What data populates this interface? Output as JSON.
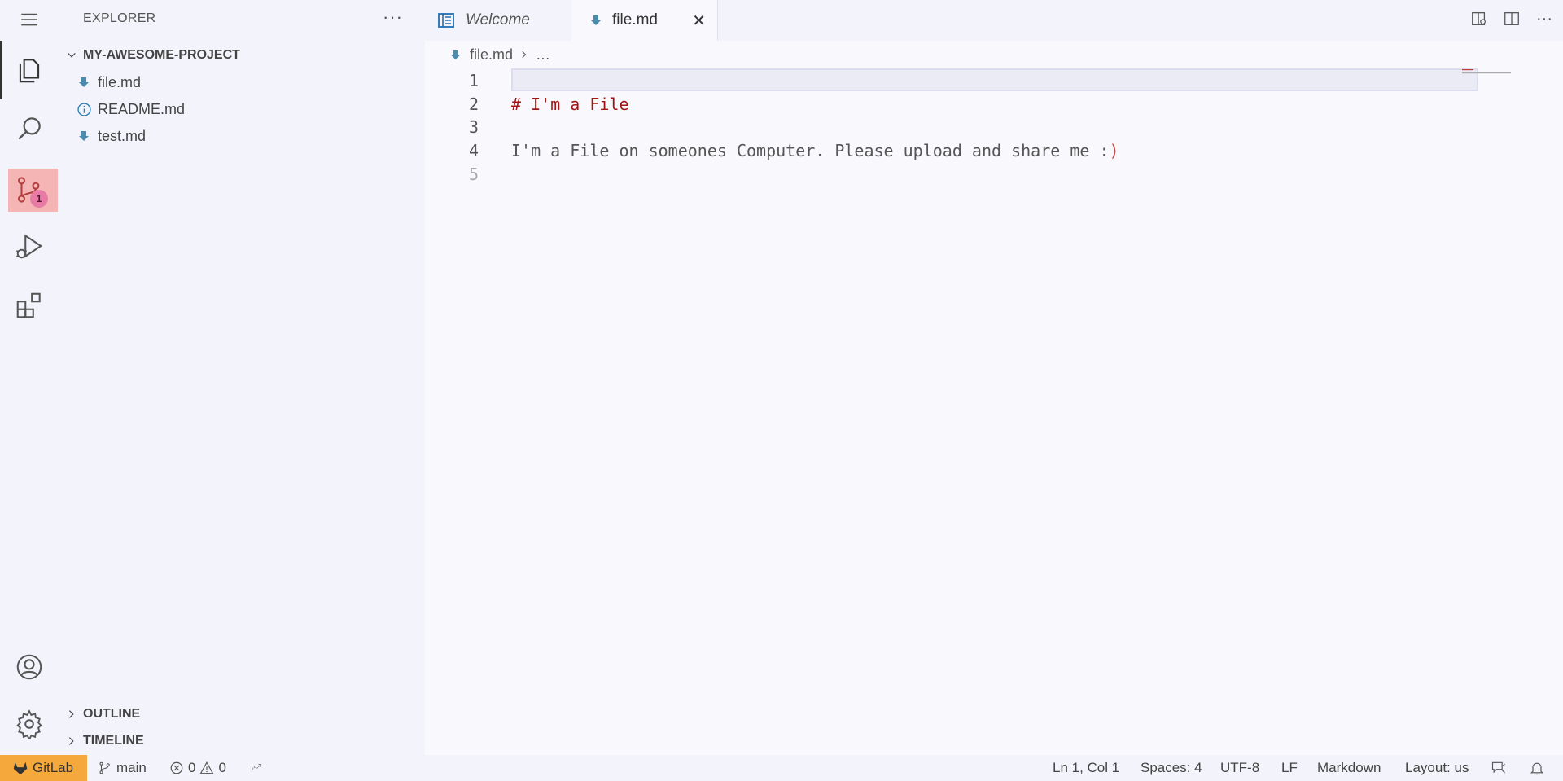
{
  "activity_bar": {
    "items": [
      "menu-icon",
      "files-icon",
      "search-icon",
      "source-control-icon",
      "run-debug-icon",
      "extensions-icon",
      "accounts-icon",
      "settings-icon"
    ],
    "source_control_badge": "1",
    "annotation": "<~"
  },
  "sidebar": {
    "title": "EXPLORER",
    "more": "···",
    "project": "MY-AWESOME-PROJECT",
    "files": [
      {
        "name": "file.md",
        "icon": "markdown-icon"
      },
      {
        "name": "README.md",
        "icon": "info-icon"
      },
      {
        "name": "test.md",
        "icon": "markdown-icon"
      }
    ],
    "outline": "OUTLINE",
    "timeline": "TIMELINE"
  },
  "tabs": [
    {
      "label": "Welcome",
      "active": false
    },
    {
      "label": "file.md",
      "active": true
    }
  ],
  "breadcrumb": {
    "file": "file.md",
    "rest": "…"
  },
  "editor": {
    "lines": [
      {
        "n": "1",
        "text": ""
      },
      {
        "n": "2",
        "text": "# I'm a File"
      },
      {
        "n": "3",
        "text": ""
      },
      {
        "n": "4",
        "text": "I'm a File on someones Computer. Please upload and share me :",
        "tail": ")"
      },
      {
        "n": "5",
        "text": ""
      }
    ]
  },
  "statusbar": {
    "gitlab": "GitLab",
    "branch": "main",
    "errors": "0",
    "warnings": "0",
    "position": "Ln 1, Col 1",
    "spaces": "Spaces: 4",
    "encoding": "UTF-8",
    "eol": "LF",
    "language": "Markdown",
    "layout": "Layout: us"
  },
  "colors": {
    "accent_gitlab": "#f5a93c",
    "highlight": "#f5b5b5",
    "badge": "#e77ba6",
    "heading": "#a31515",
    "markdown_icon": "#4a8cb0",
    "info_icon": "#2e7fb5"
  }
}
